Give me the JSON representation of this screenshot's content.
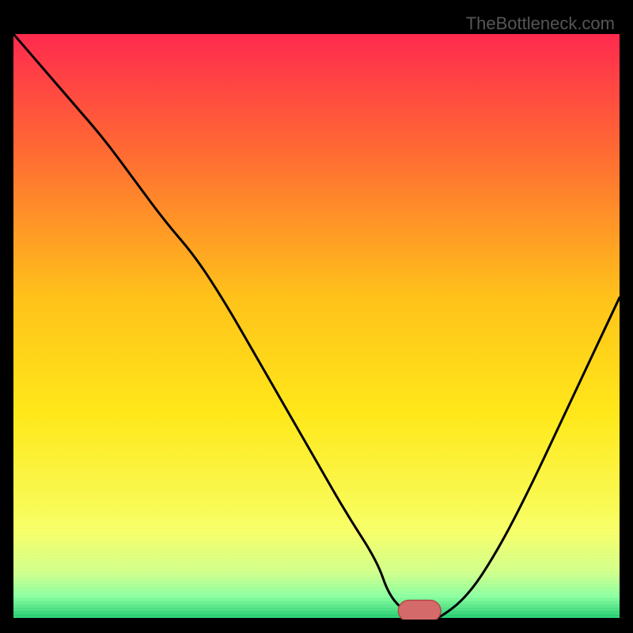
{
  "watermark": "TheBottleneck.com",
  "colors": {
    "grad_top": "#ff2a4f",
    "grad_mid1": "#ff6a33",
    "grad_mid2": "#ffc21a",
    "grad_mid3": "#ffe81a",
    "grad_low1": "#f7ff66",
    "grad_low2": "#cfff8a",
    "grad_low3": "#8aff9e",
    "grad_bottom": "#18c76b",
    "curve": "#000000",
    "marker_fill": "#d46a6a",
    "marker_stroke": "#b44848"
  },
  "chart_data": {
    "type": "line",
    "title": "",
    "xlabel": "",
    "ylabel": "",
    "xlim": [
      0,
      100
    ],
    "ylim": [
      0,
      100
    ],
    "series": [
      {
        "name": "bottleneck-curve",
        "x": [
          0,
          5,
          10,
          15,
          20,
          25,
          30,
          35,
          40,
          45,
          50,
          55,
          60,
          62,
          65,
          68,
          70,
          75,
          80,
          85,
          90,
          95,
          100
        ],
        "y": [
          100,
          94,
          88,
          82,
          75,
          68,
          62,
          54,
          45,
          36,
          27,
          18,
          10,
          4,
          1,
          0,
          0,
          4,
          12,
          22,
          33,
          44,
          55
        ]
      }
    ],
    "marker": {
      "x": 67,
      "y": 1.5,
      "rx": 3.5,
      "ry": 1.8
    }
  }
}
